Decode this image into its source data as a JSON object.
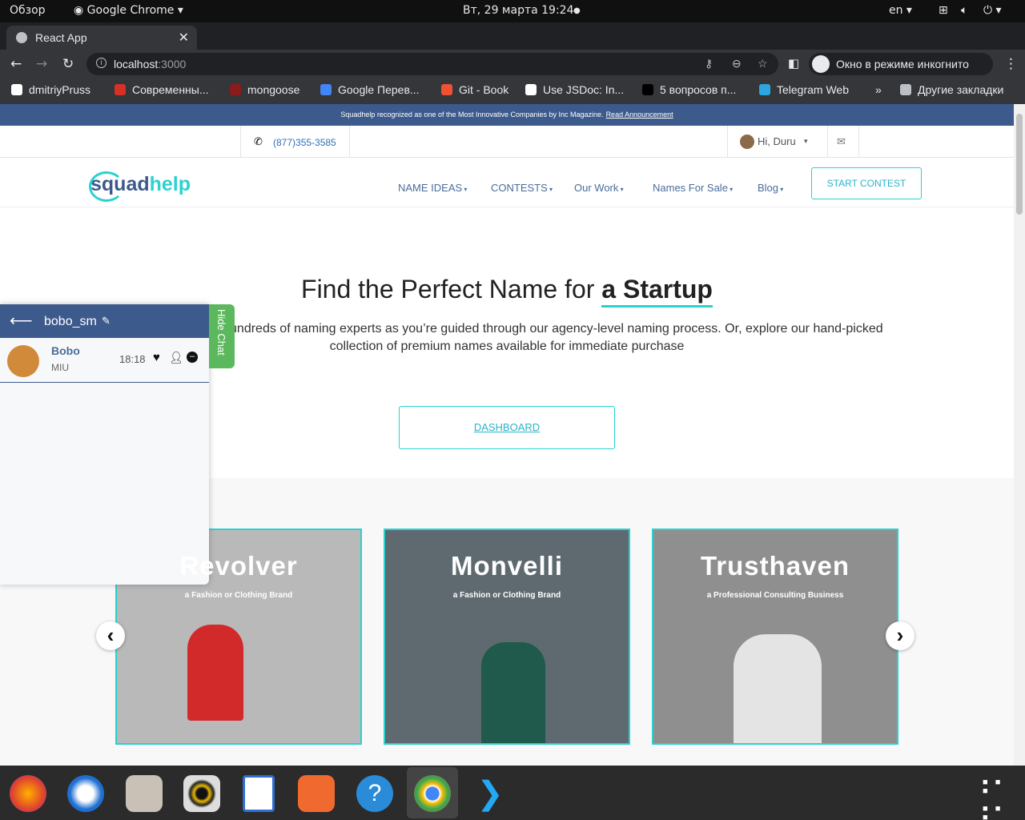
{
  "system": {
    "overview": "Обзор",
    "app": "Google Chrome ▾",
    "datetime": "Вт, 29 марта  19:24",
    "lang": "en ▾"
  },
  "browser": {
    "tab_title": "React App",
    "url_host": "localhost",
    "url_port": ":3000",
    "incognito": "Окно в режиме инкогнито",
    "bookmarks": [
      {
        "label": "dmitriyPruss",
        "color": "#ffffff"
      },
      {
        "label": "Современны...",
        "color": "#d93025"
      },
      {
        "label": "mongoose",
        "color": "#8b1a1a"
      },
      {
        "label": "Google Перев...",
        "color": "#4285f4"
      },
      {
        "label": "Git - Book",
        "color": "#f05133"
      },
      {
        "label": "Use JSDoc: In...",
        "color": "#ffffff"
      },
      {
        "label": "5 вопросов п...",
        "color": "#000000"
      },
      {
        "label": "Telegram Web",
        "color": "#2ca5e0"
      }
    ],
    "other_bookmarks": "Другие закладки"
  },
  "site": {
    "banner_text": "Squadhelp recognized as one of the Most Innovative Companies by Inc Magazine.",
    "banner_link": "Read Announcement",
    "phone": "(877)355-3585",
    "greeting": "Hi, Duru",
    "logo_a": "squad",
    "logo_b": "help",
    "menu": [
      "NAME IDEAS",
      "CONTESTS",
      "Our Work",
      "Names For Sale",
      "Blog"
    ],
    "start_contest": "START CONTEST",
    "hero_title": "Find the Perfect Name for",
    "hero_title_bold": "a Startup",
    "hero_sub": "ntest to engage hundreds of naming experts as you’re guided through our agency-level naming process. Or, explore our hand-picked collection of premium names available for immediate purchase",
    "dashboard": "DASHBOARD",
    "cards": [
      {
        "name": "Revolver",
        "sub": "a Fashion or Clothing Brand",
        "bg": "#b9b9b9"
      },
      {
        "name": "Monvelli",
        "sub": "a Fashion or Clothing Brand",
        "bg": "#5e6a70"
      },
      {
        "name": "Trusthaven",
        "sub": "a Professional Consulting Business",
        "bg": "#8f8f8f"
      }
    ]
  },
  "chat": {
    "user": "bobo_sm",
    "contact_name": "Bobo",
    "contact_sub": "MIU",
    "time": "18:18",
    "hide": "Hide Chat"
  }
}
